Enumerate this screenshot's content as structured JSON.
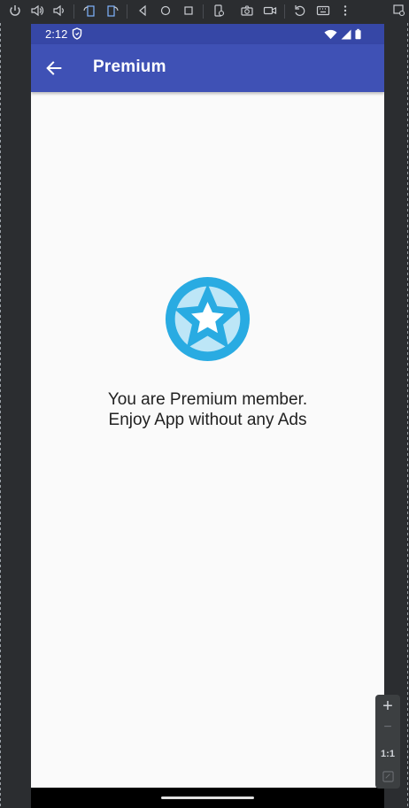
{
  "emulator": {
    "toolbar_icons": [
      "power-icon",
      "volume-up-icon",
      "volume-down-icon",
      "rotate-left-icon",
      "rotate-right-icon",
      "back-nav-icon",
      "home-nav-icon",
      "overview-nav-icon",
      "fold-icon",
      "camera-icon",
      "screen-record-icon",
      "undo-icon",
      "keyboard-icon",
      "more-icon",
      "device-frame-icon"
    ],
    "zoom": {
      "plus": "+",
      "minus": "−",
      "ratio": "1:1"
    }
  },
  "status_bar": {
    "time": "2:12",
    "background": "#3647a6"
  },
  "app_bar": {
    "title": "Premium",
    "background": "#3f51b5"
  },
  "content": {
    "line1": "You are Premium member.",
    "line2": "Enjoy App without any Ads",
    "badge_icon": "premium-star-badge-icon",
    "badge_color": "#29abe2",
    "badge_light": "#bde6f7"
  }
}
